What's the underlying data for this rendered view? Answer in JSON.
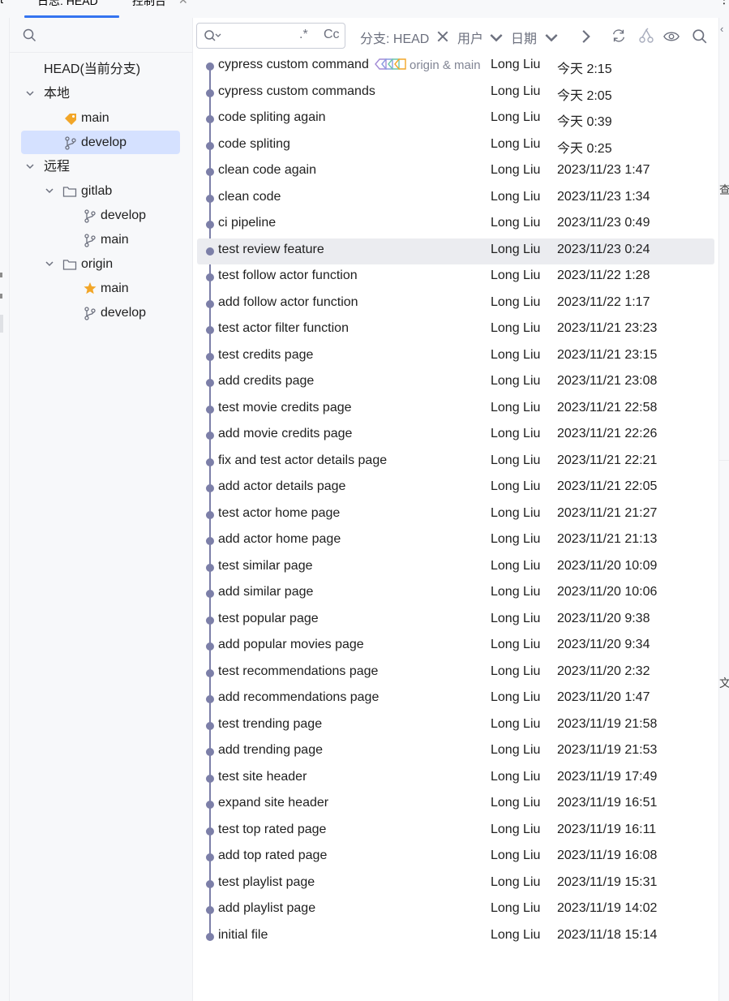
{
  "tabs": {
    "items": [
      {
        "label": "日志: HEAD",
        "active": true
      },
      {
        "label": "控制台",
        "active": false
      }
    ],
    "left_fragment": "t",
    "right_fragment": "⋮"
  },
  "branch_tree": {
    "search_placeholder": "",
    "head": "HEAD(当前分支)",
    "local": {
      "label": "本地",
      "branches": [
        {
          "name": "main",
          "icon": "tag-icon"
        },
        {
          "name": "develop",
          "icon": "branch-icon",
          "selected": true
        }
      ]
    },
    "remote": {
      "label": "远程",
      "groups": [
        {
          "name": "gitlab",
          "branches": [
            {
              "name": "develop",
              "icon": "branch-icon"
            },
            {
              "name": "main",
              "icon": "branch-icon"
            }
          ]
        },
        {
          "name": "origin",
          "branches": [
            {
              "name": "main",
              "icon": "star-icon"
            },
            {
              "name": "develop",
              "icon": "branch-icon"
            }
          ]
        }
      ]
    }
  },
  "toolbar": {
    "filter_value": "",
    "regex_label": ".*",
    "case_label": "Cc",
    "branch_filter": "分支: HEAD",
    "user_filter": "用户",
    "date_filter": "日期"
  },
  "colors": {
    "accent": "#3574f0",
    "graph": "#7c7fa8",
    "selection": "#d5e1ff",
    "row_highlight": "#ebecf0",
    "tag": "#f2a628"
  },
  "commits": [
    {
      "message": "cypress custom commands",
      "refs": "origin & main",
      "author": "Long Liu",
      "date": "今天 2:15"
    },
    {
      "message": "cypress custom commands",
      "refs": "",
      "author": "Long Liu",
      "date": "今天 2:05"
    },
    {
      "message": "code spliting again",
      "refs": "",
      "author": "Long Liu",
      "date": "今天 0:39"
    },
    {
      "message": "code spliting",
      "refs": "",
      "author": "Long Liu",
      "date": "今天 0:25"
    },
    {
      "message": "clean code again",
      "refs": "",
      "author": "Long Liu",
      "date": "2023/11/23 1:47"
    },
    {
      "message": "clean code",
      "refs": "",
      "author": "Long Liu",
      "date": "2023/11/23 1:34"
    },
    {
      "message": "ci pipeline",
      "refs": "",
      "author": "Long Liu",
      "date": "2023/11/23 0:49"
    },
    {
      "message": "test review feature",
      "refs": "",
      "author": "Long Liu",
      "date": "2023/11/23 0:24",
      "highlight": true
    },
    {
      "message": "test follow actor function",
      "refs": "",
      "author": "Long Liu",
      "date": "2023/11/22 1:28"
    },
    {
      "message": "add follow actor function",
      "refs": "",
      "author": "Long Liu",
      "date": "2023/11/22 1:17"
    },
    {
      "message": "test actor filter function",
      "refs": "",
      "author": "Long Liu",
      "date": "2023/11/21 23:23"
    },
    {
      "message": "test credits page",
      "refs": "",
      "author": "Long Liu",
      "date": "2023/11/21 23:15"
    },
    {
      "message": "add credits page",
      "refs": "",
      "author": "Long Liu",
      "date": "2023/11/21 23:08"
    },
    {
      "message": "test movie credits page",
      "refs": "",
      "author": "Long Liu",
      "date": "2023/11/21 22:58"
    },
    {
      "message": "add movie credits page",
      "refs": "",
      "author": "Long Liu",
      "date": "2023/11/21 22:26"
    },
    {
      "message": "fix and test actor details page",
      "refs": "",
      "author": "Long Liu",
      "date": "2023/11/21 22:21"
    },
    {
      "message": "add actor details page",
      "refs": "",
      "author": "Long Liu",
      "date": "2023/11/21 22:05"
    },
    {
      "message": "test actor home page",
      "refs": "",
      "author": "Long Liu",
      "date": "2023/11/21 21:27"
    },
    {
      "message": "add actor home page",
      "refs": "",
      "author": "Long Liu",
      "date": "2023/11/21 21:13"
    },
    {
      "message": "test similar page",
      "refs": "",
      "author": "Long Liu",
      "date": "2023/11/20 10:09"
    },
    {
      "message": "add similar page",
      "refs": "",
      "author": "Long Liu",
      "date": "2023/11/20 10:06"
    },
    {
      "message": "test popular page",
      "refs": "",
      "author": "Long Liu",
      "date": "2023/11/20 9:38"
    },
    {
      "message": "add popular movies page",
      "refs": "",
      "author": "Long Liu",
      "date": "2023/11/20 9:34"
    },
    {
      "message": "test recommendations page",
      "refs": "",
      "author": "Long Liu",
      "date": "2023/11/20 2:32"
    },
    {
      "message": "add recommendations page",
      "refs": "",
      "author": "Long Liu",
      "date": "2023/11/20 1:47"
    },
    {
      "message": "test trending page",
      "refs": "",
      "author": "Long Liu",
      "date": "2023/11/19 21:58"
    },
    {
      "message": "add trending page",
      "refs": "",
      "author": "Long Liu",
      "date": "2023/11/19 21:53"
    },
    {
      "message": "test site header",
      "refs": "",
      "author": "Long Liu",
      "date": "2023/11/19 17:49"
    },
    {
      "message": "expand site header",
      "refs": "",
      "author": "Long Liu",
      "date": "2023/11/19 16:51"
    },
    {
      "message": "test top rated page",
      "refs": "",
      "author": "Long Liu",
      "date": "2023/11/19 16:11"
    },
    {
      "message": "add top rated page",
      "refs": "",
      "author": "Long Liu",
      "date": "2023/11/19 16:08"
    },
    {
      "message": "test playlist page",
      "refs": "",
      "author": "Long Liu",
      "date": "2023/11/19 15:31"
    },
    {
      "message": "add playlist page",
      "refs": "",
      "author": "Long Liu",
      "date": "2023/11/19 14:02"
    },
    {
      "message": "initial file",
      "refs": "",
      "author": "Long Liu",
      "date": "2023/11/18 15:14"
    }
  ],
  "right_strip": {
    "char_1": "查",
    "char_2": "文"
  }
}
